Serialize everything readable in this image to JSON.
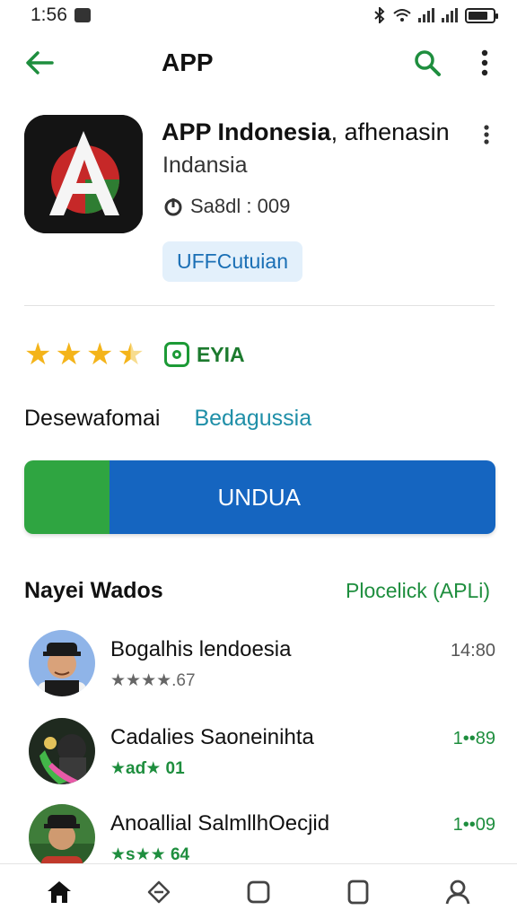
{
  "status_bar": {
    "time": "1:56"
  },
  "top_bar": {
    "title": "APP",
    "back_icon": "arrow-left-icon",
    "search_icon": "search-icon",
    "more_icon": "more-vert-icon"
  },
  "app": {
    "name_bold": "APP Indonesia",
    "name_rest": ", afhenasin",
    "developer": "Indansia",
    "size_label": "Sa8dl : 009",
    "chip_label": "UFFCutuian",
    "accent": "#1e8e3e"
  },
  "rating": {
    "stars": 3.5,
    "max": 5,
    "badge_label": "EYIA"
  },
  "language": {
    "label": "Desewafomai",
    "value": "Bedagussia"
  },
  "install": {
    "label": "UNDUA",
    "progress_fraction": 0.18,
    "green": "#2fa541",
    "blue": "#1565c0"
  },
  "reviews": {
    "title": "Nayei Wados",
    "see_all": "Plocelick (APLi)",
    "items": [
      {
        "name": "Bogalhis lendoesia",
        "meta": "★★★★.67",
        "time": "14:80"
      },
      {
        "name": "Cadalies Saoneinihta",
        "meta": "★aɗ★ 01",
        "time": "1••89"
      },
      {
        "name": "Anoallial SalmllhOecjid",
        "meta": "★s★★ 64",
        "time": "1••09"
      }
    ]
  },
  "bottom_nav": {
    "items": [
      "home-icon",
      "tag-icon",
      "square-icon",
      "page-icon",
      "profile-icon"
    ]
  }
}
